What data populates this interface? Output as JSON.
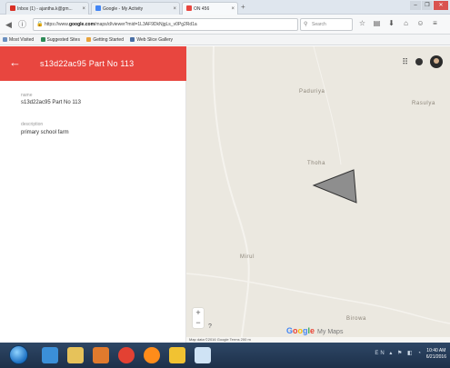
{
  "browser": {
    "tabs": [
      {
        "label": "Inbox (1) - ajantha.k@gm...",
        "fav_color": "#d93025"
      },
      {
        "label": "Google - My Activity",
        "fav_color": "#4285f4"
      },
      {
        "label": "ON 456",
        "fav_color": "#e8463f"
      }
    ],
    "tab_close": "×",
    "new_tab": "+",
    "window_buttons": [
      "–",
      "❐",
      "✕"
    ],
    "url_prefix": "https://www.",
    "url_domain": "google.com",
    "url_rest": "/maps/d/viewer?mid=1L3AF9DkNjgLs_v0Pg2Rd1a",
    "reload_glyph": "C",
    "search_placeholder": "Search",
    "toolbar_icons": [
      "☆",
      "▤",
      "⬇",
      "⌂",
      "☺",
      "≡"
    ],
    "bookmarks": [
      {
        "label": "Most Visited",
        "color": "#6a8fbf"
      },
      {
        "label": "Suggested Sites",
        "color": "#2e8b57"
      },
      {
        "label": "Getting Started",
        "color": "#e8a33c"
      },
      {
        "label": "Web Slice Gallery",
        "color": "#4a6fa5"
      }
    ]
  },
  "app": {
    "header_color": "#e8463f",
    "back_glyph": "←",
    "title": "s13d22ac95 Part No 113",
    "fields": [
      {
        "label": "name",
        "value": "s13d22ac95 Part No 113"
      },
      {
        "label": "description",
        "value": "primary school farm"
      }
    ]
  },
  "map": {
    "background": "#ebe8e0",
    "places": [
      {
        "name": "Paduriya"
      },
      {
        "name": "Rasulya"
      },
      {
        "name": "Thoha"
      },
      {
        "name": "Mirul"
      },
      {
        "name": "Birowa"
      }
    ],
    "zoom_in": "+",
    "zoom_out": "−",
    "logo_text": "Google",
    "logo_suffix": "My Maps",
    "attribution": "Map data ©2016 Google  Terms  200 m",
    "polygon_fill": "#8e8e8e",
    "polygon_stroke": "#333333",
    "icons": [
      "grid-icon",
      "more-icon",
      "account-avatar"
    ]
  },
  "taskbar": {
    "apps": [
      {
        "name": "internet-explorer-icon",
        "color": "#3b8fd8"
      },
      {
        "name": "file-explorer-icon",
        "color": "#e6c25a"
      },
      {
        "name": "media-player-icon",
        "color": "#e07a2d"
      },
      {
        "name": "chrome-icon",
        "color": "#e34133"
      },
      {
        "name": "firefox-icon",
        "color": "#ff8c1a"
      },
      {
        "name": "paint-icon",
        "color": "#f1c232"
      },
      {
        "name": "notes-icon",
        "color": "#cfe3f5"
      }
    ],
    "tray_text": "EN ▴ ⚑ ◧ ◔",
    "time": "10:40 AM",
    "date": "6/21/2016"
  }
}
